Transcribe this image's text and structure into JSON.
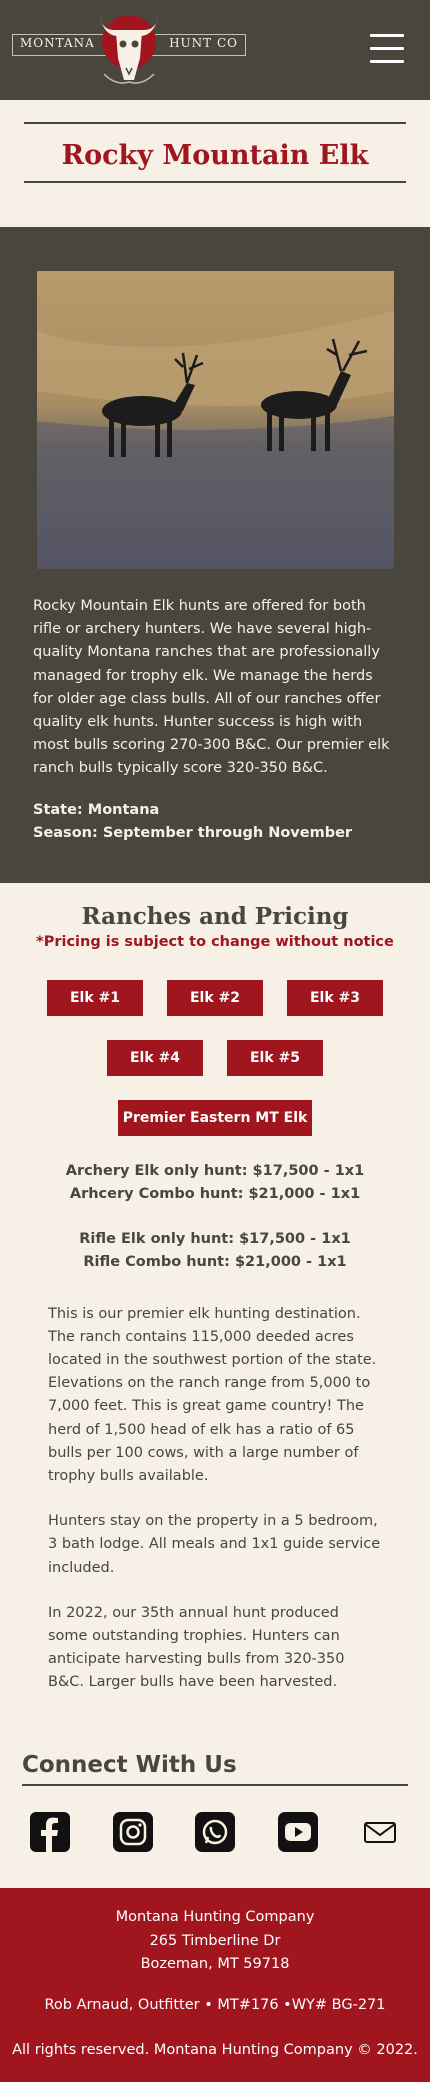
{
  "header": {
    "logo_left": "Montana",
    "logo_right": "Hunt Co",
    "menu_icon": "hamburger-icon"
  },
  "page": {
    "title": "Rocky Mountain Elk"
  },
  "intro": {
    "description": "Rocky Mountain Elk hunts are offered for both rifle or archery hunters. We have several high-quality Montana ranches that are professionally managed for trophy elk. We manage the herds for older age class bulls. All of our ranches offer quality elk hunts. Hunter success is high with most bulls scoring 270-300 B&C. Our premier elk ranch bulls typically score 320-350 B&C.",
    "state": "State: Montana",
    "season": "Season: September through November"
  },
  "ranches": {
    "title": "Ranches and Pricing",
    "notice": "*Pricing is subject to change without notice",
    "buttons": [
      "Elk #1",
      "Elk #2",
      "Elk #3",
      "Elk #4",
      "Elk #5",
      "Premier Eastern MT Elk"
    ],
    "prices": [
      "Archery Elk only hunt: $17,500 - 1x1",
      "Arhcery Combo hunt: $21,000 - 1x1",
      "Rifle Elk only hunt: $17,500 - 1x1",
      "Rifle Combo hunt: $21,000 - 1x1"
    ],
    "paragraphs": [
      "This is our premier elk hunting destination. The ranch contains 115,000 deeded acres located in the southwest portion of the state. Elevations on the ranch range from 5,000 to 7,000 feet. This is great game country! The herd of 1,500 head of elk has a ratio of 65 bulls per 100 cows, with a large number of trophy bulls available.",
      "Hunters stay on the property in a 5 bedroom, 3 bath lodge. All meals and 1x1 guide service included.",
      "In 2022, our 35th annual hunt produced some outstanding trophies. Hunters can anticipate harvesting bulls from 320-350 B&C. Larger bulls have been harvested."
    ]
  },
  "connect": {
    "title": "Connect With Us",
    "icons": [
      "facebook-icon",
      "instagram-icon",
      "whatsapp-icon",
      "youtube-icon",
      "email-icon"
    ]
  },
  "footer": {
    "company": "Montana Hunting Company",
    "street": "265 Timberline Dr",
    "city": "Bozeman, MT 59718",
    "license": "Rob Arnaud, Outfitter • MT#176 •WY# BG-271",
    "copyright": "All rights reserved. Montana Hunting Company © 2022."
  },
  "colors": {
    "brand_red": "#a0151e",
    "dark": "#4a463d",
    "cream": "#f6f0e6"
  }
}
